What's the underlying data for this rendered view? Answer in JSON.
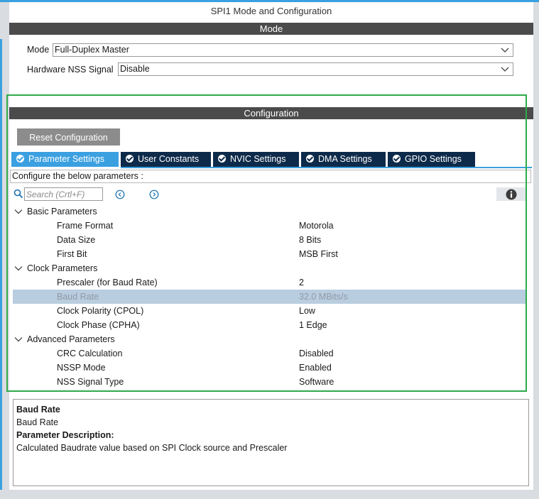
{
  "window": {
    "title": "SPI1 Mode and Configuration"
  },
  "mode": {
    "header": "Mode",
    "fields": [
      {
        "label": "Mode",
        "value": "Full-Duplex Master"
      },
      {
        "label": "Hardware NSS Signal",
        "value": "Disable"
      }
    ]
  },
  "configuration": {
    "header": "Configuration",
    "reset_label": "Reset Configuration",
    "tabs": [
      {
        "label": "Parameter Settings",
        "active": true
      },
      {
        "label": "User Constants",
        "active": false
      },
      {
        "label": "NVIC Settings",
        "active": false
      },
      {
        "label": "DMA Settings",
        "active": false
      },
      {
        "label": "GPIO Settings",
        "active": false
      }
    ],
    "hint": "Configure the below parameters :",
    "search": {
      "placeholder": "Search (Crtl+F)"
    },
    "groups": [
      {
        "label": "Basic Parameters",
        "params": [
          {
            "name": "Frame Format",
            "value": "Motorola"
          },
          {
            "name": "Data Size",
            "value": "8 Bits"
          },
          {
            "name": "First Bit",
            "value": "MSB First"
          }
        ]
      },
      {
        "label": "Clock Parameters",
        "params": [
          {
            "name": "Prescaler (for Baud Rate)",
            "value": "2"
          },
          {
            "name": "Baud Rate",
            "value": "32.0 MBits/s",
            "selected": true
          },
          {
            "name": "Clock Polarity (CPOL)",
            "value": "Low"
          },
          {
            "name": "Clock Phase (CPHA)",
            "value": "1 Edge"
          }
        ]
      },
      {
        "label": "Advanced Parameters",
        "params": [
          {
            "name": "CRC Calculation",
            "value": "Disabled"
          },
          {
            "name": "NSSP Mode",
            "value": "Enabled"
          },
          {
            "name": "NSS Signal Type",
            "value": "Software"
          }
        ]
      }
    ]
  },
  "description": {
    "title": "Baud Rate",
    "name": "Baud Rate",
    "section_label": "Parameter Description:",
    "text": "Calculated Baudrate value based on SPI Clock source and Prescaler"
  },
  "colors": {
    "accent": "#3aa0e0",
    "tab_bg": "#0e2a4a",
    "header_bg": "#4b4b4b",
    "highlight_frame": "#2eaa4a",
    "selected_row": "#b9cde0"
  }
}
